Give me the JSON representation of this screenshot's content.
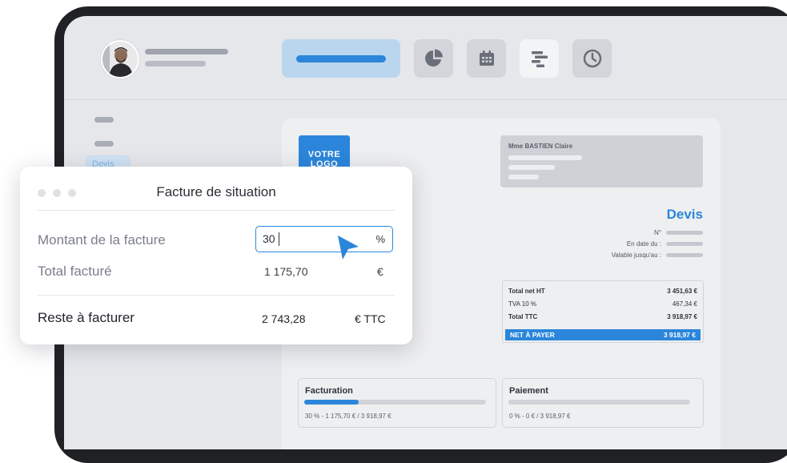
{
  "document": {
    "logo_line1": "VOTRE",
    "logo_line2": "LOGO",
    "client_name": "Mme BASTIEN Claire",
    "title": "Devis",
    "meta": [
      {
        "label": "N°"
      },
      {
        "label": "En date du :"
      },
      {
        "label": "Valable jusqu'au :"
      }
    ],
    "totals": {
      "net_ht": {
        "label": "Total net HT",
        "value": "3 451,63 €"
      },
      "tva": {
        "label": "TVA 10 %",
        "value": "467,34 €"
      },
      "ttc": {
        "label": "Total TTC",
        "value": "3 918,97 €"
      },
      "net_a_payer": {
        "label": "NET À PAYER",
        "value": "3 918,97 €"
      }
    },
    "facturation": {
      "title": "Facturation",
      "progress": 0.3,
      "summary": "30 % - 1 175,70 € / 3 918,97 €"
    },
    "paiement": {
      "title": "Paiement",
      "progress": 0,
      "summary": "0 % - 0 € / 3 918,97 €"
    }
  },
  "sidebar": {
    "chip_label": "Devis"
  },
  "panel": {
    "title": "Facture de situation",
    "montant_label": "Montant de la facture",
    "montant_value": "30",
    "montant_unit": "%",
    "total_label": "Total facturé",
    "total_value": "1 175,70",
    "total_unit": "€",
    "reste_label": "Reste à facturer",
    "reste_value": "2 743,28",
    "reste_unit": "€ TTC"
  },
  "colors": {
    "accent": "#2b86db",
    "screen_bg": "#e6e7eb",
    "frame": "#202124"
  },
  "icons": [
    "pie-chart-icon",
    "calendar-icon",
    "gantt-icon",
    "clock-icon",
    "cursor-arrow-icon"
  ]
}
